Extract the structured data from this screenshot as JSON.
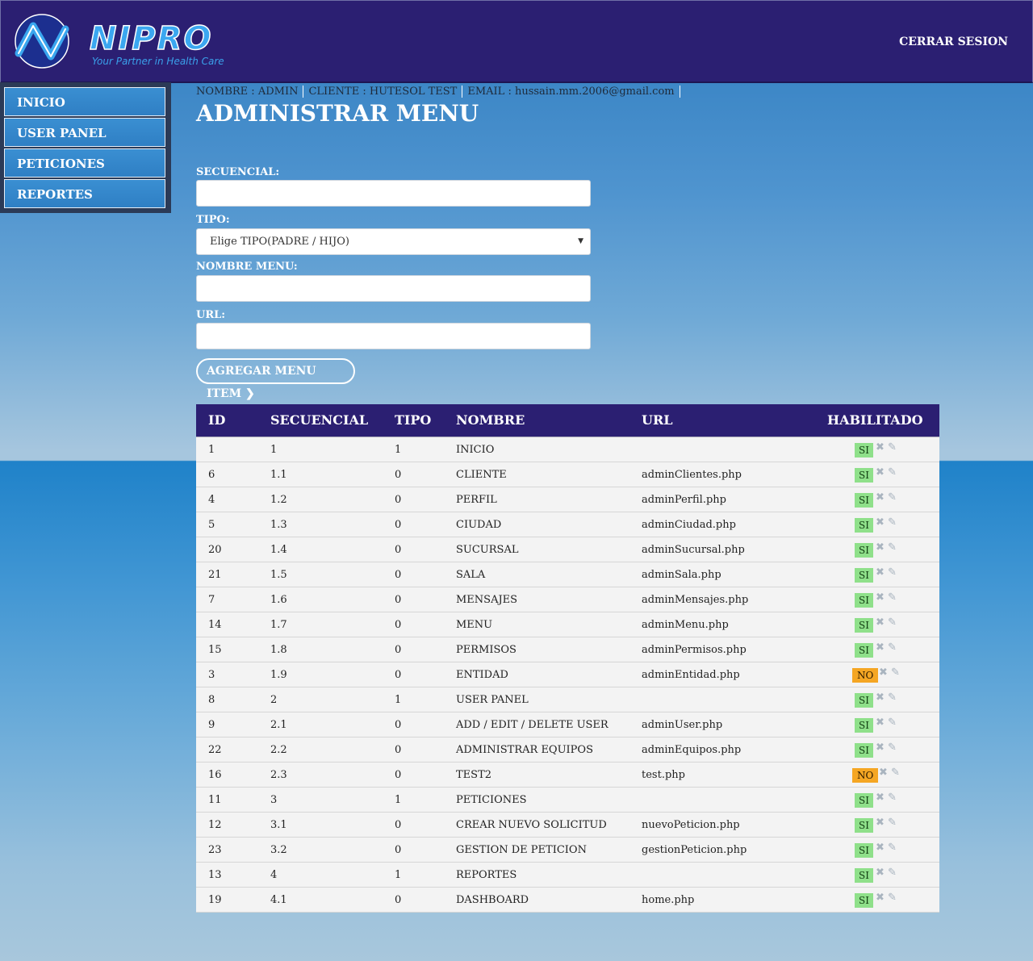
{
  "header": {
    "logo_word": "NIPRO",
    "logo_tagline": "Your Partner in Health Care",
    "logout_label": "CERRAR SESION"
  },
  "sidebar": {
    "items": [
      {
        "label": "INICIO"
      },
      {
        "label": "USER PANEL"
      },
      {
        "label": "PETICIONES"
      },
      {
        "label": "REPORTES"
      }
    ]
  },
  "userinfo": {
    "nombre": "NOMBRE : ADMIN",
    "cliente": "CLIENTE : HUTESOL TEST",
    "email": "EMAIL : hussain.mm.2006@gmail.com"
  },
  "page_title": "ADMINISTRAR MENU",
  "form": {
    "secuencial_label": "SECUENCIAL:",
    "secuencial_value": "",
    "tipo_label": "TIPO:",
    "tipo_selected": "Elige TIPO(PADRE / HIJO)",
    "nombre_label": "NOMBRE MENU:",
    "nombre_value": "",
    "url_label": "URL:",
    "url_value": "",
    "submit_label": "AGREGAR MENU ITEM"
  },
  "table": {
    "headers": {
      "id": "ID",
      "secuencial": "SECUENCIAL",
      "tipo": "TIPO",
      "nombre": "NOMBRE",
      "url": "URL",
      "habilitado": "HABILITADO"
    },
    "rows": [
      {
        "id": "1",
        "secuencial": "1",
        "tipo": "1",
        "nombre": "INICIO",
        "url": "",
        "habilitado": "SI"
      },
      {
        "id": "6",
        "secuencial": "1.1",
        "tipo": "0",
        "nombre": "CLIENTE",
        "url": "adminClientes.php",
        "habilitado": "SI"
      },
      {
        "id": "4",
        "secuencial": "1.2",
        "tipo": "0",
        "nombre": "PERFIL",
        "url": "adminPerfil.php",
        "habilitado": "SI"
      },
      {
        "id": "5",
        "secuencial": "1.3",
        "tipo": "0",
        "nombre": "CIUDAD",
        "url": "adminCiudad.php",
        "habilitado": "SI"
      },
      {
        "id": "20",
        "secuencial": "1.4",
        "tipo": "0",
        "nombre": "SUCURSAL",
        "url": "adminSucursal.php",
        "habilitado": "SI"
      },
      {
        "id": "21",
        "secuencial": "1.5",
        "tipo": "0",
        "nombre": "SALA",
        "url": "adminSala.php",
        "habilitado": "SI"
      },
      {
        "id": "7",
        "secuencial": "1.6",
        "tipo": "0",
        "nombre": "MENSAJES",
        "url": "adminMensajes.php",
        "habilitado": "SI"
      },
      {
        "id": "14",
        "secuencial": "1.7",
        "tipo": "0",
        "nombre": "MENU",
        "url": "adminMenu.php",
        "habilitado": "SI"
      },
      {
        "id": "15",
        "secuencial": "1.8",
        "tipo": "0",
        "nombre": "PERMISOS",
        "url": "adminPermisos.php",
        "habilitado": "SI"
      },
      {
        "id": "3",
        "secuencial": "1.9",
        "tipo": "0",
        "nombre": "ENTIDAD",
        "url": "adminEntidad.php",
        "habilitado": "NO"
      },
      {
        "id": "8",
        "secuencial": "2",
        "tipo": "1",
        "nombre": "USER PANEL",
        "url": "",
        "habilitado": "SI"
      },
      {
        "id": "9",
        "secuencial": "2.1",
        "tipo": "0",
        "nombre": "ADD / EDIT / DELETE USER",
        "url": "adminUser.php",
        "habilitado": "SI"
      },
      {
        "id": "22",
        "secuencial": "2.2",
        "tipo": "0",
        "nombre": "ADMINISTRAR EQUIPOS",
        "url": "adminEquipos.php",
        "habilitado": "SI"
      },
      {
        "id": "16",
        "secuencial": "2.3",
        "tipo": "0",
        "nombre": "TEST2",
        "url": "test.php",
        "habilitado": "NO"
      },
      {
        "id": "11",
        "secuencial": "3",
        "tipo": "1",
        "nombre": "PETICIONES",
        "url": "",
        "habilitado": "SI"
      },
      {
        "id": "12",
        "secuencial": "3.1",
        "tipo": "0",
        "nombre": "CREAR NUEVO SOLICITUD",
        "url": "nuevoPeticion.php",
        "habilitado": "SI"
      },
      {
        "id": "23",
        "secuencial": "3.2",
        "tipo": "0",
        "nombre": "GESTION DE PETICION",
        "url": "gestionPeticion.php",
        "habilitado": "SI"
      },
      {
        "id": "13",
        "secuencial": "4",
        "tipo": "1",
        "nombre": "REPORTES",
        "url": "",
        "habilitado": "SI"
      },
      {
        "id": "19",
        "secuencial": "4.1",
        "tipo": "0",
        "nombre": "DASHBOARD",
        "url": "home.php",
        "habilitado": "SI"
      }
    ]
  },
  "icons": {
    "delete": "close-icon",
    "edit": "pencil-icon",
    "submit_arrow": "chevron-right-icon"
  },
  "colors": {
    "header_bg": "#2b1f72",
    "si_badge": "#8fe08a",
    "no_badge": "#f5a623",
    "sidebar_item": "#3a8fd2"
  }
}
